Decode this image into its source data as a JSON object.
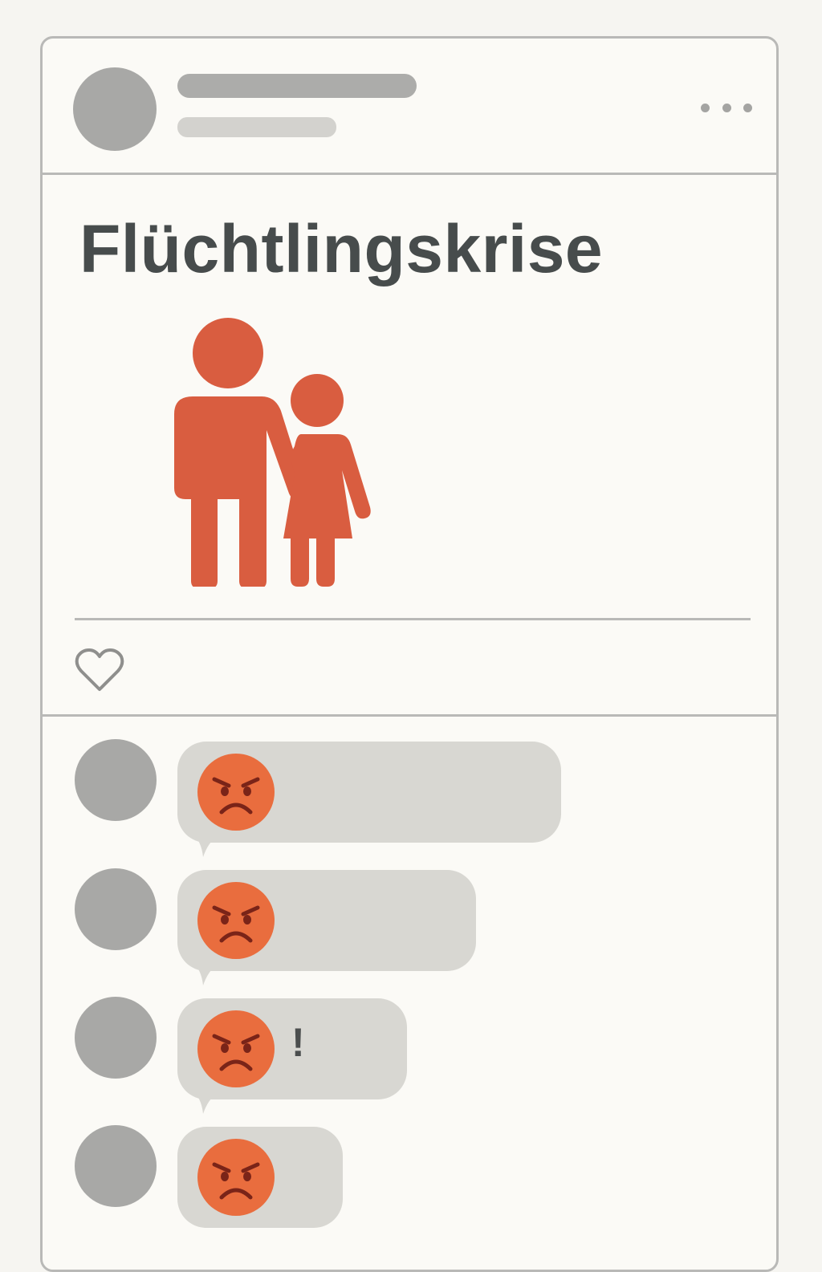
{
  "post": {
    "title": "Flüchtlingskrise",
    "image_icon": "parent-and-child-icon",
    "menu_icon": "more-options-icon",
    "like_icon": "heart-outline-icon"
  },
  "comments": [
    {
      "emoji": "angry-face-icon",
      "text": ""
    },
    {
      "emoji": "angry-face-icon",
      "text": ""
    },
    {
      "emoji": "angry-face-icon",
      "text": "!"
    },
    {
      "emoji": "angry-face-icon",
      "text": ""
    }
  ],
  "colors": {
    "accent": "#d95d40",
    "emoji_face": "#e96d3e",
    "emoji_features": "#7a2418",
    "title": "#474c4c",
    "placeholder": "#a8a8a6",
    "bubble": "#d8d7d2",
    "border": "#b9b9b7"
  }
}
